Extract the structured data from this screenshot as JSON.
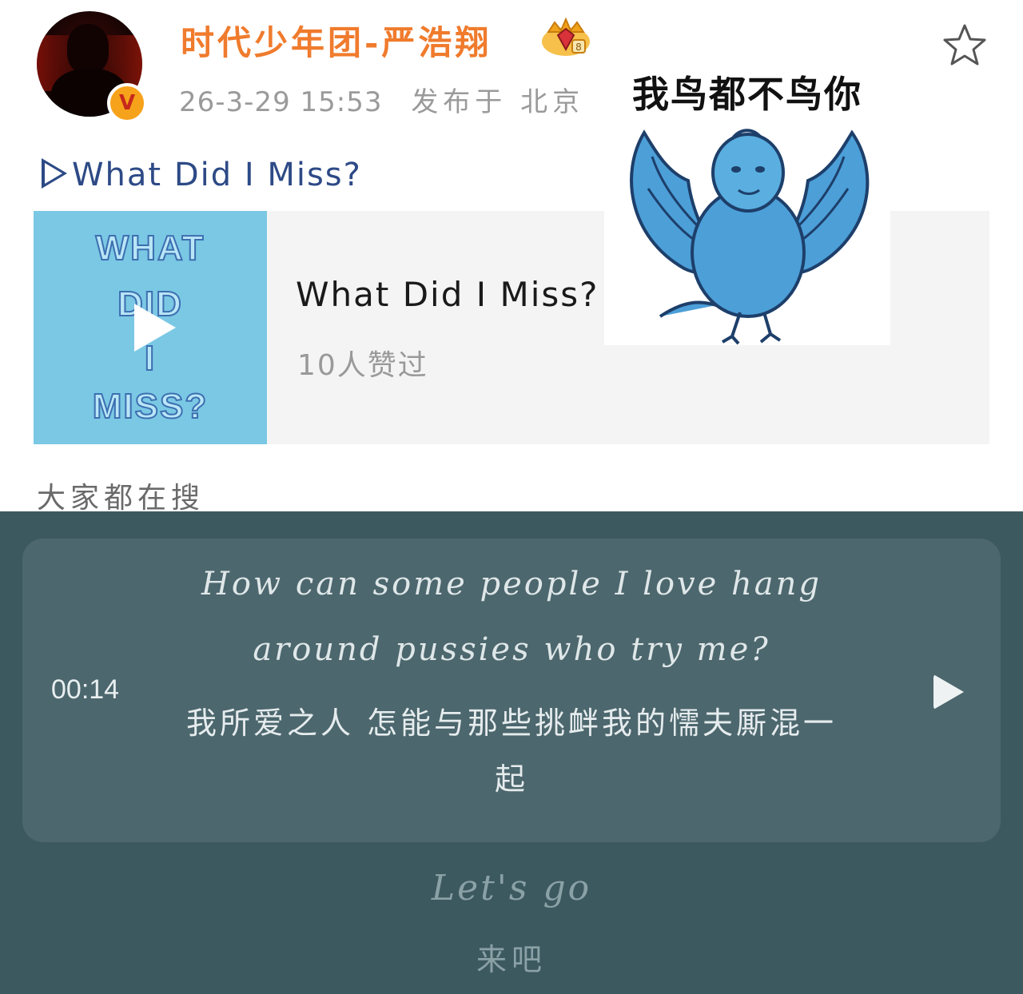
{
  "post": {
    "username": "时代少年团-严浩翔",
    "verified_badge": "V",
    "timestamp": "26-3-29 15:53",
    "location": "发布于 北京",
    "link_title": "What Did I Miss?",
    "icons": {
      "crown": "crown-badge-icon",
      "favorite": "star-icon",
      "link": "play-triangle-icon"
    }
  },
  "music_card": {
    "title": "What Did I Miss?",
    "likes": "10人赞过",
    "cover_text": [
      "WHAT",
      "DID",
      "I",
      "MISS?"
    ]
  },
  "meme": {
    "caption": "我鸟都不鸟你"
  },
  "search_hint": "大家都在搜",
  "lyrics": {
    "current_time": "00:14",
    "current_en_line1": "How can some people I love hang",
    "current_en_line2": "around pussies who try me?",
    "current_zh_line1": "我所爱之人 怎能与那些挑衅我的懦夫厮混一",
    "current_zh_line2": "起",
    "next_en": "Let's go",
    "next_zh": "来吧"
  },
  "colors": {
    "username": "#f07b2d",
    "link": "#2d4a86",
    "lyrics_bg": "#3d5960",
    "lyric_card_bg": "#4c676d",
    "cover_bg": "#7ac8e4"
  }
}
